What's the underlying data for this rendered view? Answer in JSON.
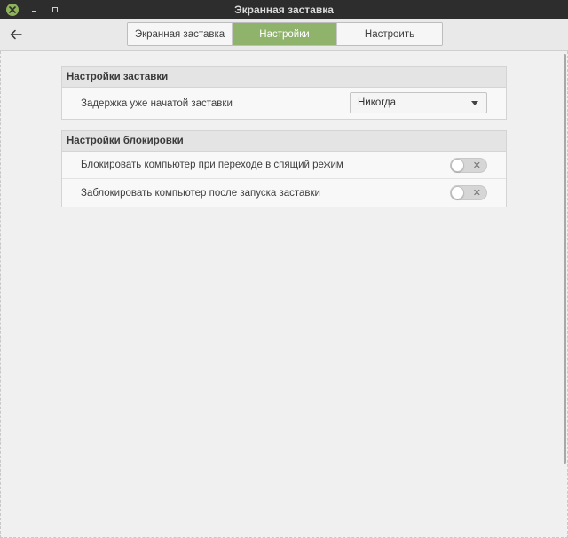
{
  "window": {
    "title": "Экранная заставка"
  },
  "tabs": [
    {
      "label": "Экранная заставка",
      "active": false
    },
    {
      "label": "Настройки",
      "active": true
    },
    {
      "label": "Настроить",
      "active": false
    }
  ],
  "sections": {
    "screensaver": {
      "header": "Настройки заставки",
      "delay_label": "Задержка уже начатой заставки",
      "delay_value": "Никогда"
    },
    "lock": {
      "header": "Настройки блокировки",
      "lock_on_suspend_label": "Блокировать компьютер при переходе в спящий режим",
      "lock_on_suspend_on": false,
      "lock_after_screensaver_label": "Заблокировать компьютер после запуска заставки",
      "lock_after_screensaver_on": false
    }
  },
  "colors": {
    "accent": "#8fb36b",
    "titlebar": "#2d2d2d"
  },
  "icons": {
    "close": "close-icon",
    "back": "back-arrow-icon",
    "dropdown": "chevron-down-icon",
    "toggle_off": "x-icon"
  }
}
